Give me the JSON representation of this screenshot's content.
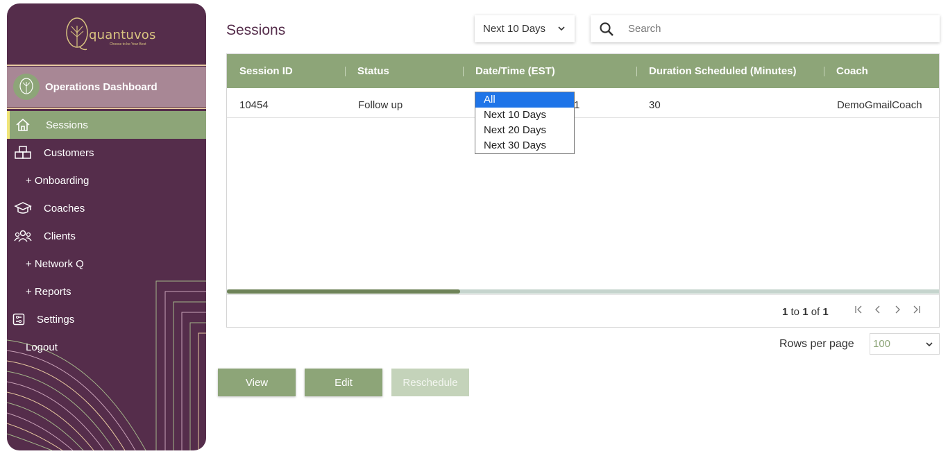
{
  "brand": {
    "name": "quantuvos",
    "tagline": "Choose to be Your Best"
  },
  "sidebar": {
    "header_title": "Operations Dashboard",
    "items": [
      {
        "label": "Sessions",
        "icon": "home-icon",
        "active": true
      },
      {
        "label": "Customers",
        "icon": "boxes-icon"
      },
      {
        "label": "+ Onboarding",
        "icon": null
      },
      {
        "label": "Coaches",
        "icon": "graduation-cap-icon"
      },
      {
        "label": "Clients",
        "icon": "users-icon"
      },
      {
        "label": "+ Network Q",
        "icon": null
      },
      {
        "label": "+ Reports",
        "icon": null
      },
      {
        "label": "Settings",
        "icon": "settings-icon"
      },
      {
        "label": "Logout",
        "icon": null
      }
    ]
  },
  "main": {
    "title": "Sessions",
    "filter": {
      "selected": "Next 10 Days",
      "options": [
        "All",
        "Next 10 Days",
        "Next 20 Days",
        "Next 30 Days"
      ],
      "highlighted": "All"
    },
    "search": {
      "placeholder": "Search",
      "value": ""
    },
    "table": {
      "columns": [
        "Session ID",
        "Status",
        "Date/Time (EST)",
        "Duration Scheduled (Minutes)",
        "Coach"
      ],
      "rows": [
        {
          "session_id": "10454",
          "status": "Follow up",
          "datetime_fragment": "1",
          "duration": "30",
          "coach": "DemoGmailCoach"
        }
      ],
      "pager": {
        "from": "1",
        "to_word": "to",
        "to": "1",
        "of_word": "of",
        "total": "1"
      }
    },
    "rows_per_page": {
      "label": "Rows per page",
      "value": "100"
    },
    "actions": {
      "view": "View",
      "edit": "Edit",
      "reschedule": "Reschedule"
    }
  },
  "colors": {
    "sidebar": "#552d4b",
    "accent_green": "#8da578",
    "highlight": "#1e74e8",
    "gold": "#d9c480"
  }
}
